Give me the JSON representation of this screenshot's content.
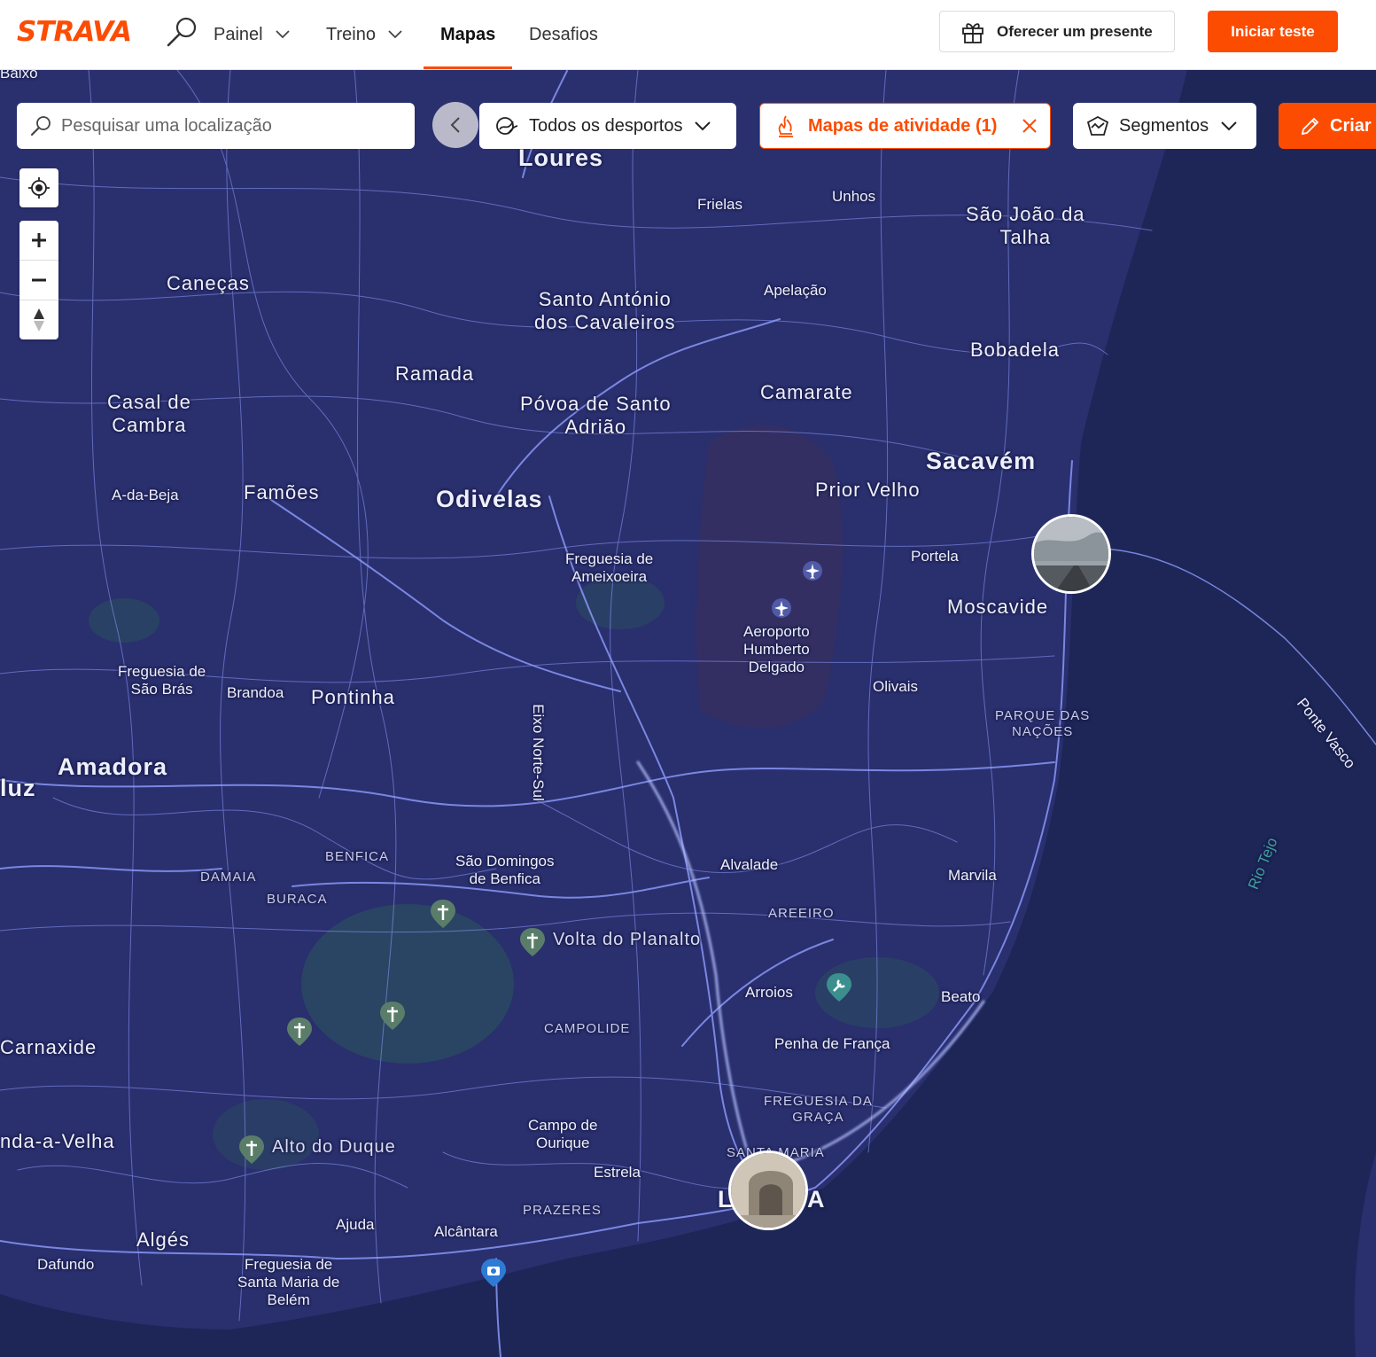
{
  "header": {
    "logo": "STRAVA",
    "nav": [
      {
        "label": "Painel",
        "dropdown": true
      },
      {
        "label": "Treino",
        "dropdown": true
      },
      {
        "label": "Mapas",
        "active": true
      },
      {
        "label": "Desafios"
      }
    ],
    "gift_label": "Oferecer um presente",
    "trial_label": "Iniciar teste",
    "accent": "#fc4c02"
  },
  "toolbar": {
    "search_placeholder": "Pesquisar uma localização",
    "sports_label": "Todos os desportos",
    "heatmap_label": "Mapas de atividade (1)",
    "segments_label": "Segmentos",
    "create_label": "Criar"
  },
  "map": {
    "labels": {
      "baixo": "Baixo",
      "loures": "Loures",
      "frielas": "Frielas",
      "unhos": "Unhos",
      "sao_joao": "São João da\nTalha",
      "canecas": "Caneças",
      "santo_antonio": "Santo António\ndos Cavaleiros",
      "apelacao": "Apelação",
      "bobadela": "Bobadela",
      "ramada": "Ramada",
      "casal": "Casal de\nCambra",
      "povoa": "Póvoa de Santo\nAdrião",
      "camarate": "Camarate",
      "sacavem": "Sacavém",
      "a_da_beja": "A-da-Beja",
      "famoes": "Famões",
      "odivelas": "Odivelas",
      "prior_velho": "Prior Velho",
      "ameixoeira": "Freguesia de\nAmeixoeira",
      "portela": "Portela",
      "moscavide": "Moscavide",
      "aeroporto": "Aeroporto\nHumberto\nDelgado",
      "sao_bras": "Freguesia de\nSão Brás",
      "brandoa": "Brandoa",
      "pontinha": "Pontinha",
      "eixo": "Eixo Norte-Sul",
      "olivais": "Olivais",
      "parque": "PARQUE DAS\nNAÇÕES",
      "ponte": "Ponte Vasco",
      "amadora": "Amadora",
      "luz": "luz",
      "benfica": "BENFICA",
      "sao_domingos": "São Domingos\nde Benfica",
      "damaia": "DAMAIA",
      "alvalade": "Alvalade",
      "marvila": "Marvila",
      "rio_tejo": "Rio Tejo",
      "buraca": "BURACA",
      "areeiro": "AREEIRO",
      "volta": "Volta do Planalto",
      "arroios": "Arroios",
      "beato": "Beato",
      "campolide": "CAMPOLIDE",
      "penha": "Penha de França",
      "carnaxide": "Carnaxide",
      "graca": "FREGUESIA DA\nGRAÇA",
      "campo_ourique": "Campo de\nOurique",
      "cruz_quebrada": "nda-a-Velha",
      "alto_duque": "Alto do Duque",
      "santa_maria": "SANTA MARIA",
      "estrela": "Estrela",
      "lisboa": "L          A",
      "prazeres": "PRAZERES",
      "ajuda": "Ajuda",
      "alcantara": "Alcântara",
      "alges": "Algés",
      "dafundo": "Dafundo",
      "belem": "Freguesia de\nSanta Maria de\nBelém"
    },
    "colors": {
      "land": "#2a2f6e",
      "water": "#1d2657",
      "routes": "#8f9dff",
      "park": "#2a4f5e"
    }
  }
}
